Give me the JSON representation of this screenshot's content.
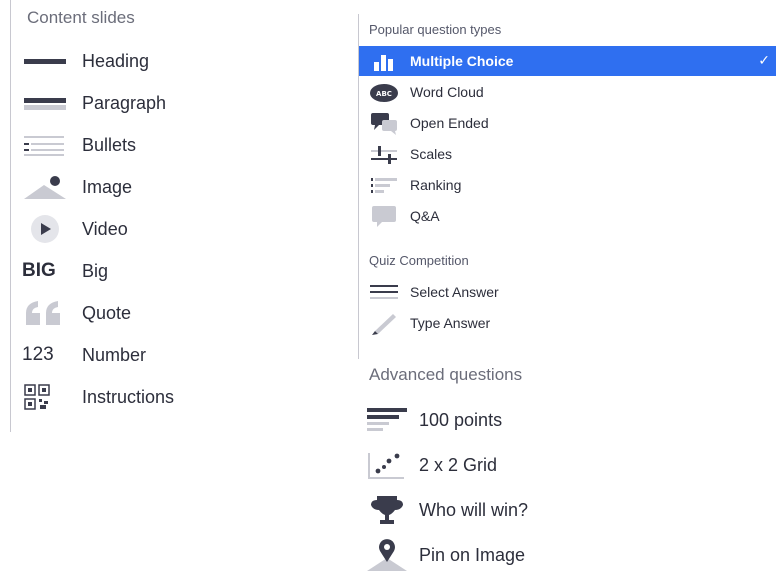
{
  "content_slides": {
    "heading": "Content slides",
    "items": [
      {
        "label": "Heading",
        "icon": "heading-icon"
      },
      {
        "label": "Paragraph",
        "icon": "paragraph-icon"
      },
      {
        "label": "Bullets",
        "icon": "bullets-icon"
      },
      {
        "label": "Image",
        "icon": "image-icon"
      },
      {
        "label": "Video",
        "icon": "video-icon"
      },
      {
        "label": "Big",
        "icon": "big-icon",
        "icon_text": "BIG"
      },
      {
        "label": "Quote",
        "icon": "quote-icon"
      },
      {
        "label": "Number",
        "icon": "number-icon",
        "icon_text": "123"
      },
      {
        "label": "Instructions",
        "icon": "instructions-icon"
      }
    ]
  },
  "popular": {
    "heading": "Popular question types",
    "items": [
      {
        "label": "Multiple Choice",
        "icon": "bar-chart-icon",
        "selected": true,
        "check": "✓"
      },
      {
        "label": "Word Cloud",
        "icon": "word-cloud-icon",
        "icon_text": "ABC"
      },
      {
        "label": "Open Ended",
        "icon": "speech-bubbles-icon"
      },
      {
        "label": "Scales",
        "icon": "scales-icon"
      },
      {
        "label": "Ranking",
        "icon": "ranking-icon"
      },
      {
        "label": "Q&A",
        "icon": "qa-bubble-icon"
      }
    ]
  },
  "quiz": {
    "heading": "Quiz Competition",
    "items": [
      {
        "label": "Select Answer",
        "icon": "select-answer-icon"
      },
      {
        "label": "Type Answer",
        "icon": "pencil-icon"
      }
    ]
  },
  "advanced": {
    "heading": "Advanced questions",
    "items": [
      {
        "label": "100 points",
        "icon": "points-icon"
      },
      {
        "label": "2 x 2 Grid",
        "icon": "grid-scatter-icon"
      },
      {
        "label": "Who will win?",
        "icon": "trophy-icon"
      },
      {
        "label": "Pin on Image",
        "icon": "pin-icon"
      }
    ]
  },
  "colors": {
    "accent": "#2f6ff0",
    "icon_dark": "#3a3c4c",
    "icon_light": "#c9cad2"
  }
}
